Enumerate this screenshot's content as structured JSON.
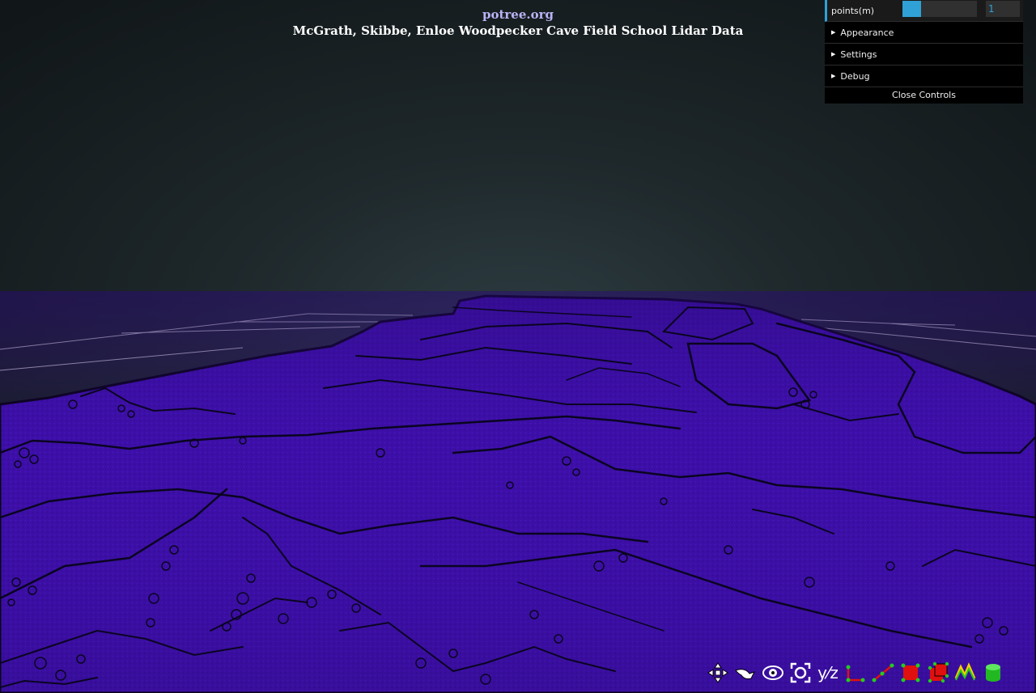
{
  "header": {
    "site": "potree.org",
    "title": "McGrath, Skibbe, Enloe Woodpecker Cave Field School Lidar Data"
  },
  "controls": {
    "points_label": "points(m)",
    "points_value": "1",
    "points_fill_fraction": 0.25,
    "folders": [
      "Appearance",
      "Settings",
      "Debug"
    ],
    "close_label": "Close Controls"
  },
  "colors": {
    "pointcloud": "#3d0fa8",
    "pointcloud_edge": "#08041a",
    "grid": "#c8c8c8",
    "accent": "#2fa1d6"
  },
  "toolbar": {
    "tools": [
      {
        "icon": "navigation-arrows-icon"
      },
      {
        "icon": "fly-mode-icon"
      },
      {
        "icon": "orbit-view-icon"
      },
      {
        "icon": "focus-icon"
      },
      {
        "icon": "y-z-toggle-icon",
        "text": "y⁄z"
      },
      {
        "icon": "angle-measure-icon"
      },
      {
        "icon": "distance-measure-icon"
      },
      {
        "icon": "area-measure-icon"
      },
      {
        "icon": "volume-measure-icon"
      },
      {
        "icon": "profile-tool-icon"
      },
      {
        "icon": "database-icon"
      }
    ]
  }
}
